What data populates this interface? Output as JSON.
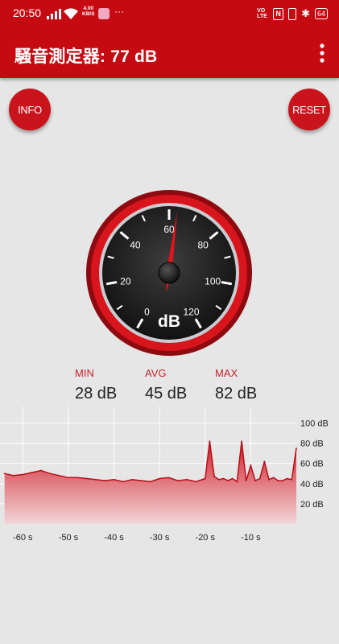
{
  "status_bar": {
    "time": "20:50",
    "net_speed_value": "4.00",
    "net_speed_unit": "KB/S",
    "more_dots": "···",
    "volte": "VO LTE",
    "battery": "64"
  },
  "app_bar": {
    "title": "騒音測定器: 77 dB"
  },
  "buttons": {
    "info": "INFO",
    "reset": "RESET"
  },
  "gauge": {
    "unit": "dB",
    "ticks": [
      "0",
      "20",
      "40",
      "60",
      "80",
      "100",
      "120"
    ],
    "needle_value": 63,
    "min_value": 0,
    "max_value": 120
  },
  "stats": {
    "min_label": "MIN",
    "min_value": "28 dB",
    "avg_label": "AVG",
    "avg_value": "45 dB",
    "max_label": "MAX",
    "max_value": "82 dB"
  },
  "colors": {
    "primary": "#c50a12",
    "accent": "#e0141c",
    "background": "#e6e6e6"
  },
  "chart_data": {
    "type": "area",
    "x": [
      -64,
      -62,
      -60,
      -58,
      -56,
      -54,
      -52,
      -50,
      -48,
      -46,
      -44,
      -42,
      -40,
      -38,
      -36,
      -34,
      -32,
      -30,
      -28,
      -26,
      -24,
      -22,
      -20,
      -19,
      -18,
      -17,
      -16,
      -15,
      -14,
      -13,
      -12,
      -11,
      -10,
      -9,
      -8,
      -7,
      -6,
      -5,
      -4,
      -3,
      -2,
      -1,
      0
    ],
    "values": [
      50,
      48,
      49,
      51,
      53,
      50,
      48,
      46,
      46,
      45,
      44,
      43,
      44,
      42,
      44,
      43,
      42,
      45,
      46,
      43,
      44,
      42,
      45,
      82,
      47,
      44,
      45,
      43,
      45,
      42,
      82,
      43,
      58,
      43,
      45,
      62,
      44,
      46,
      43,
      43,
      45,
      44,
      75
    ],
    "x_ticks": [
      "-60 s",
      "-50 s",
      "-40 s",
      "-30 s",
      "-20 s",
      "-10 s"
    ],
    "x_tick_values": [
      -60,
      -50,
      -40,
      -30,
      -20,
      -10
    ],
    "y_ticks": [
      "20 dB",
      "40 dB",
      "60 dB",
      "80 dB",
      "100 dB"
    ],
    "y_tick_values": [
      20,
      40,
      60,
      80,
      100
    ],
    "xlim": [
      -65,
      0
    ],
    "ylim": [
      0,
      110
    ],
    "grid": true
  }
}
